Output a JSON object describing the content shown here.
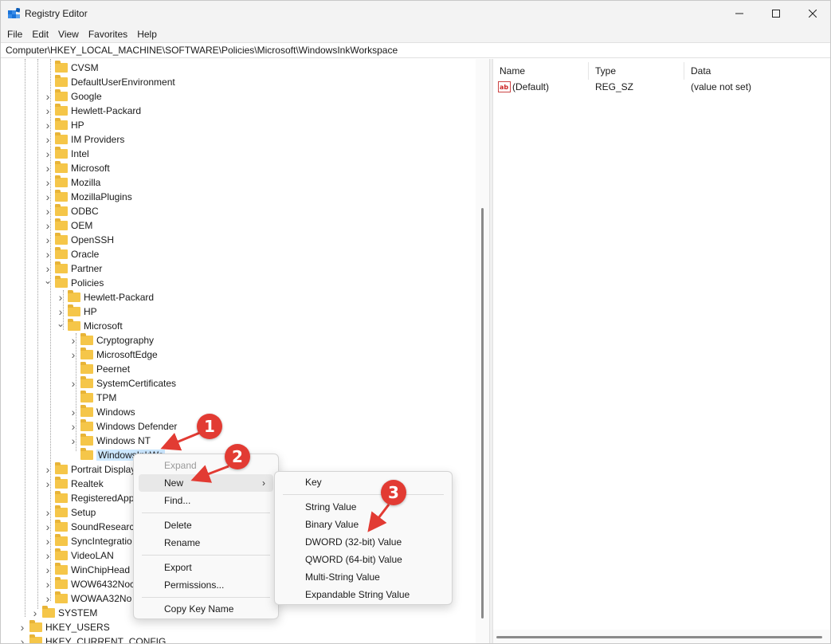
{
  "window": {
    "title": "Registry Editor",
    "minimize_label": "—",
    "maximize_label": "☐",
    "close_label": "✕"
  },
  "menu": [
    "File",
    "Edit",
    "View",
    "Favorites",
    "Help"
  ],
  "address": "Computer\\HKEY_LOCAL_MACHINE\\SOFTWARE\\Policies\\Microsoft\\WindowsInkWorkspace",
  "tree": {
    "items": [
      {
        "label": "CVSM",
        "expander": "none"
      },
      {
        "label": "DefaultUserEnvironment",
        "expander": "none"
      },
      {
        "label": "Google",
        "expander": "collapsed"
      },
      {
        "label": "Hewlett-Packard",
        "expander": "collapsed"
      },
      {
        "label": "HP",
        "expander": "collapsed"
      },
      {
        "label": "IM Providers",
        "expander": "collapsed"
      },
      {
        "label": "Intel",
        "expander": "collapsed"
      },
      {
        "label": "Microsoft",
        "expander": "collapsed"
      },
      {
        "label": "Mozilla",
        "expander": "collapsed"
      },
      {
        "label": "MozillaPlugins",
        "expander": "collapsed"
      },
      {
        "label": "ODBC",
        "expander": "collapsed"
      },
      {
        "label": "OEM",
        "expander": "collapsed"
      },
      {
        "label": "OpenSSH",
        "expander": "collapsed"
      },
      {
        "label": "Oracle",
        "expander": "collapsed"
      },
      {
        "label": "Partner",
        "expander": "collapsed"
      },
      {
        "label": "Policies",
        "expander": "expanded"
      },
      {
        "label": "Hewlett-Packard",
        "expander": "collapsed"
      },
      {
        "label": "HP",
        "expander": "collapsed"
      },
      {
        "label": "Microsoft",
        "expander": "expanded"
      },
      {
        "label": "Cryptography",
        "expander": "collapsed"
      },
      {
        "label": "MicrosoftEdge",
        "expander": "collapsed"
      },
      {
        "label": "Peernet",
        "expander": "none"
      },
      {
        "label": "SystemCertificates",
        "expander": "collapsed"
      },
      {
        "label": "TPM",
        "expander": "none"
      },
      {
        "label": "Windows",
        "expander": "collapsed"
      },
      {
        "label": "Windows Defender",
        "expander": "collapsed"
      },
      {
        "label": "Windows NT",
        "expander": "collapsed"
      },
      {
        "label": "WindowsInkWo",
        "expander": "none"
      },
      {
        "label": "Portrait Display",
        "expander": "collapsed"
      },
      {
        "label": "Realtek",
        "expander": "collapsed"
      },
      {
        "label": "RegisteredApp",
        "expander": "none"
      },
      {
        "label": "Setup",
        "expander": "collapsed"
      },
      {
        "label": "SoundResearc",
        "expander": "collapsed"
      },
      {
        "label": "SyncIntegratio",
        "expander": "collapsed"
      },
      {
        "label": "VideoLAN",
        "expander": "collapsed"
      },
      {
        "label": "WinChipHead",
        "expander": "collapsed"
      },
      {
        "label": "WOW6432Noc",
        "expander": "collapsed"
      },
      {
        "label": "WOWAA32No",
        "expander": "collapsed"
      },
      {
        "label": "SYSTEM",
        "expander": "collapsed"
      },
      {
        "label": "HKEY_USERS",
        "expander": "collapsed"
      },
      {
        "label": "HKEY_CURRENT_CONFIG",
        "expander": "collapsed"
      }
    ]
  },
  "list": {
    "columns": [
      "Name",
      "Type",
      "Data"
    ],
    "rows": [
      {
        "name": "(Default)",
        "type": "REG_SZ",
        "data": "(value not set)",
        "icon": "string-value-icon"
      }
    ]
  },
  "context_menu": {
    "items": [
      "Expand",
      "New",
      "Find...",
      "Delete",
      "Rename",
      "Export",
      "Permissions...",
      "Copy Key Name"
    ],
    "submenu_arrow": "›"
  },
  "new_submenu": {
    "items": [
      "Key",
      "String Value",
      "Binary Value",
      "DWORD (32-bit) Value",
      "QWORD (64-bit) Value",
      "Multi-String Value",
      "Expandable String Value"
    ]
  },
  "annotations": {
    "badges": [
      "1",
      "2",
      "3"
    ],
    "color": "#e23b33"
  }
}
